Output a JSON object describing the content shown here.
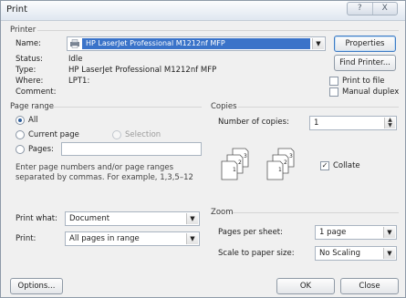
{
  "window": {
    "title": "Print",
    "controls": [
      "?",
      "X"
    ]
  },
  "printer": {
    "section": "Printer",
    "name_label": "Name:",
    "selected": "HP LaserJet Professional M1212nf MFP",
    "status_label": "Status:",
    "status_value": "Idle",
    "type_label": "Type:",
    "type_value": "HP LaserJet Professional M1212nf MFP",
    "where_label": "Where:",
    "where_value": "LPT1:",
    "comment_label": "Comment:",
    "properties_button": "Properties",
    "find_printer_button": "Find Printer...",
    "print_to_file": "Print to file",
    "manual_duplex": "Manual duplex"
  },
  "page_range": {
    "section": "Page range",
    "all": "All",
    "current_page": "Current page",
    "selection": "Selection",
    "pages": "Pages:",
    "hint_line1": "Enter page numbers and/or page ranges",
    "hint_line2": "separated by commas.  For example, 1,3,5–12",
    "selected_option": "All"
  },
  "copies": {
    "section": "Copies",
    "number_label": "Number of copies:",
    "number_value": "1",
    "collate": "Collate",
    "collate_checked": true
  },
  "print_what": {
    "label": "Print what:",
    "value": "Document"
  },
  "print_scope": {
    "label": "Print:",
    "value": "All pages in range"
  },
  "zoom": {
    "section": "Zoom",
    "pages_per_sheet_label": "Pages per sheet:",
    "pages_per_sheet_value": "1 page",
    "scale_label": "Scale to paper size:",
    "scale_value": "No Scaling"
  },
  "footer": {
    "options_button": "Options...",
    "ok_button": "OK",
    "close_button": "Close"
  },
  "colors": {
    "selection": "#3a73c9",
    "focus_border": "#3d7bc4"
  }
}
